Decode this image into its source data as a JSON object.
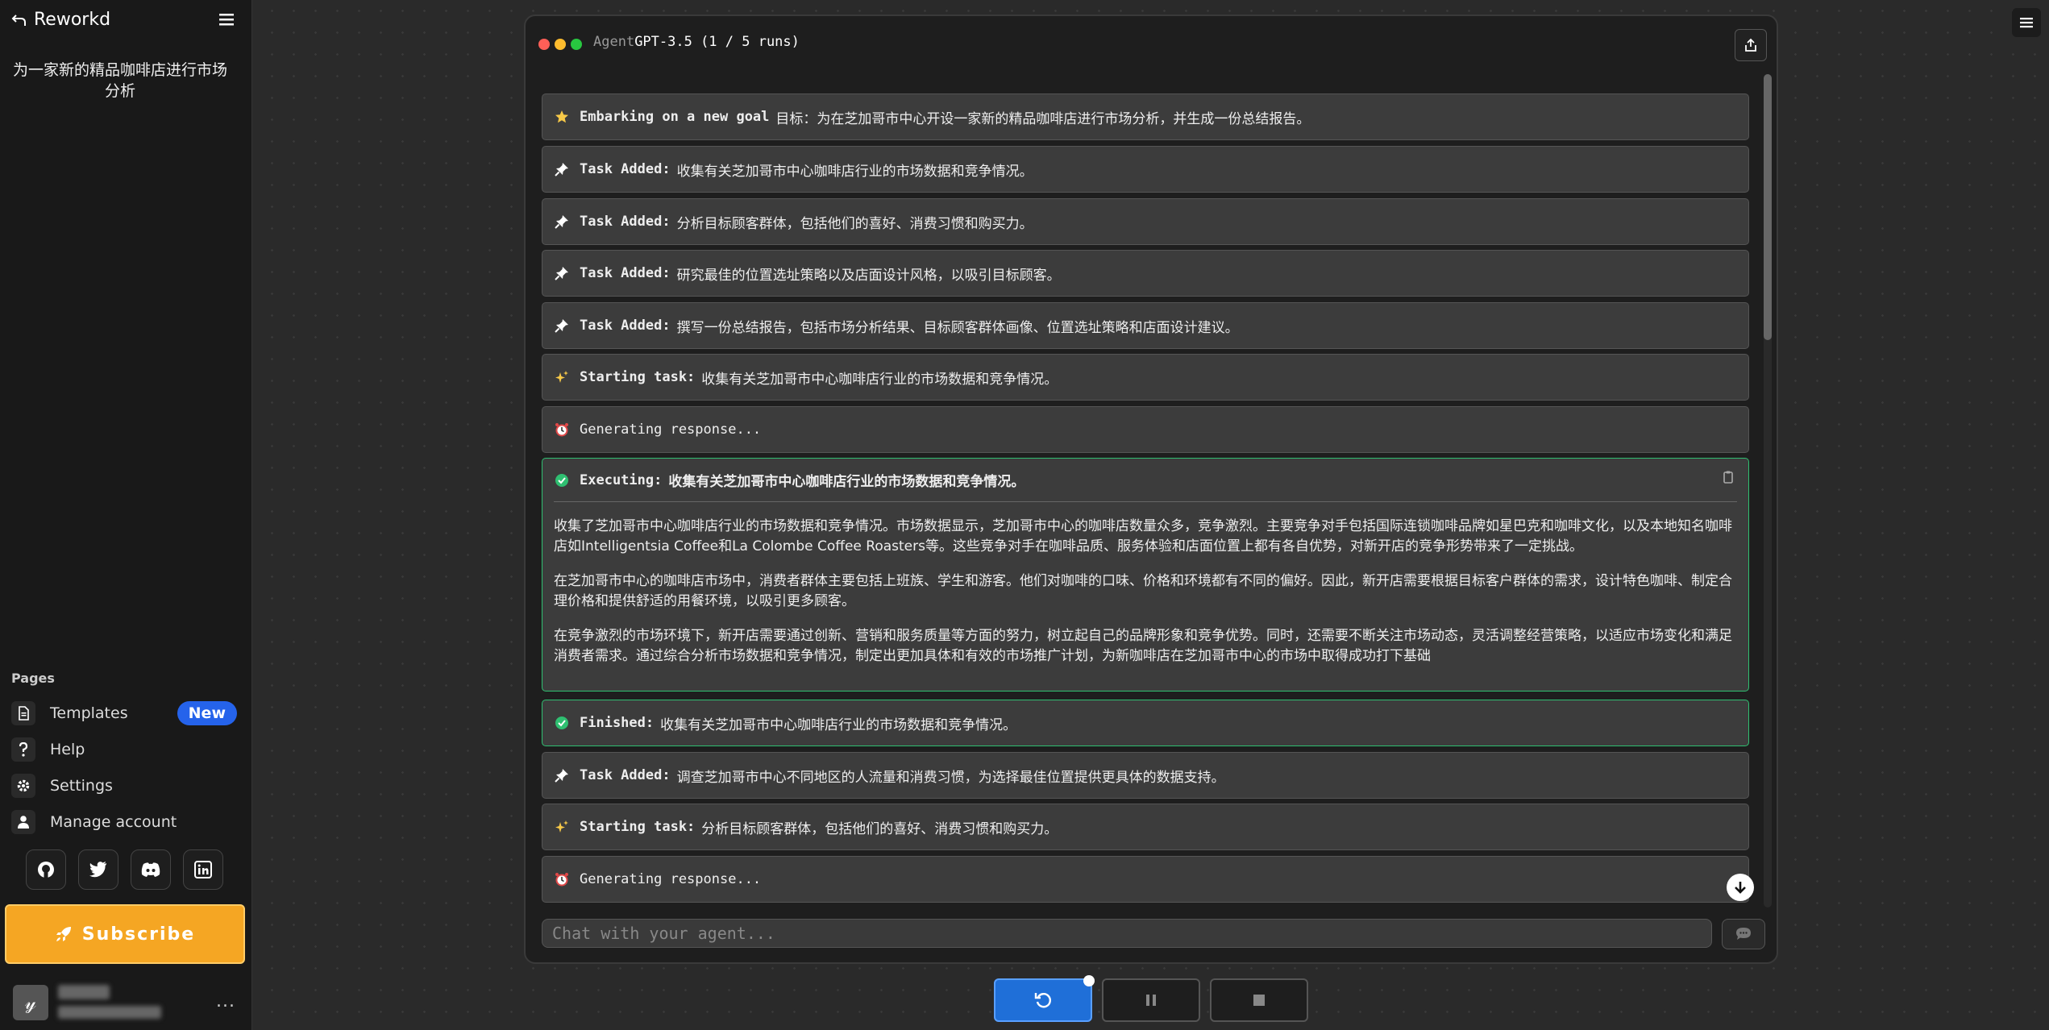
{
  "sidebar": {
    "brand": "Reworkd",
    "goal": "为一家新的精品咖啡店进行市场分析",
    "pages_label": "Pages",
    "nav": [
      {
        "label": "Templates",
        "icon": "document-icon"
      },
      {
        "label": "Help",
        "icon": "question-icon"
      },
      {
        "label": "Settings",
        "icon": "gear-icon"
      },
      {
        "label": "Manage account",
        "icon": "user-icon"
      }
    ],
    "badge": "New",
    "social": [
      "github-icon",
      "twitter-icon",
      "discord-icon",
      "linkedin-icon"
    ],
    "subscribe": "Subscribe",
    "more": "..."
  },
  "window": {
    "title_prefix": "Agent",
    "title": "GPT-3.5 (1 / 5 runs)",
    "dots": [
      "#ff5f57",
      "#febc2e",
      "#28c840"
    ]
  },
  "messages": {
    "m0": {
      "label": "Embarking on a new goal",
      "text": "目标：为在芝加哥市中心开设一家新的精品咖啡店进行市场分析，并生成一份总结报告。"
    },
    "m1": {
      "label": "Task Added:",
      "text": "收集有关芝加哥市中心咖啡店行业的市场数据和竞争情况。"
    },
    "m2": {
      "label": "Task Added:",
      "text": "分析目标顾客群体，包括他们的喜好、消费习惯和购买力。"
    },
    "m3": {
      "label": "Task Added:",
      "text": "研究最佳的位置选址策略以及店面设计风格，以吸引目标顾客。"
    },
    "m4": {
      "label": "Task Added:",
      "text": "撰写一份总结报告，包括市场分析结果、目标顾客群体画像、位置选址策略和店面设计建议。"
    },
    "m5": {
      "label": "Starting task:",
      "text": "收集有关芝加哥市中心咖啡店行业的市场数据和竞争情况。"
    },
    "m6": {
      "label": "Generating response...",
      "text": ""
    },
    "exec": {
      "label": "Executing:",
      "title": "收集有关芝加哥市中心咖啡店行业的市场数据和竞争情况。",
      "p1": "收集了芝加哥市中心咖啡店行业的市场数据和竞争情况。市场数据显示，芝加哥市中心的咖啡店数量众多，竞争激烈。主要竞争对手包括国际连锁咖啡品牌如星巴克和咖啡文化，以及本地知名咖啡店如Intelligentsia Coffee和La Colombe Coffee Roasters等。这些竞争对手在咖啡品质、服务体验和店面位置上都有各自优势，对新开店的竞争形势带来了一定挑战。",
      "p2": "在芝加哥市中心的咖啡店市场中，消费者群体主要包括上班族、学生和游客。他们对咖啡的口味、价格和环境都有不同的偏好。因此，新开店需要根据目标客户群体的需求，设计特色咖啡、制定合理价格和提供舒适的用餐环境，以吸引更多顾客。",
      "p3": "在竞争激烈的市场环境下，新开店需要通过创新、营销和服务质量等方面的努力，树立起自己的品牌形象和竞争优势。同时，还需要不断关注市场动态，灵活调整经营策略，以适应市场变化和满足消费者需求。通过综合分析市场数据和竞争情况，制定出更加具体和有效的市场推广计划，为新咖啡店在芝加哥市中心的市场中取得成功打下基础"
    },
    "m8": {
      "label": "Finished:",
      "text": "收集有关芝加哥市中心咖啡店行业的市场数据和竞争情况。"
    },
    "m9": {
      "label": "Task Added:",
      "text": "调查芝加哥市中心不同地区的人流量和消费习惯，为选择最佳位置提供更具体的数据支持。"
    },
    "m10": {
      "label": "Starting task:",
      "text": "分析目标顾客群体，包括他们的喜好、消费习惯和购买力。"
    },
    "m11": {
      "label": "Generating response...",
      "text": ""
    }
  },
  "chat": {
    "placeholder": "Chat with your agent..."
  },
  "colors": {
    "accent": "#1f6fd8",
    "success": "#2fbf71",
    "subscribe": "#f5a623",
    "badge": "#2563eb"
  }
}
